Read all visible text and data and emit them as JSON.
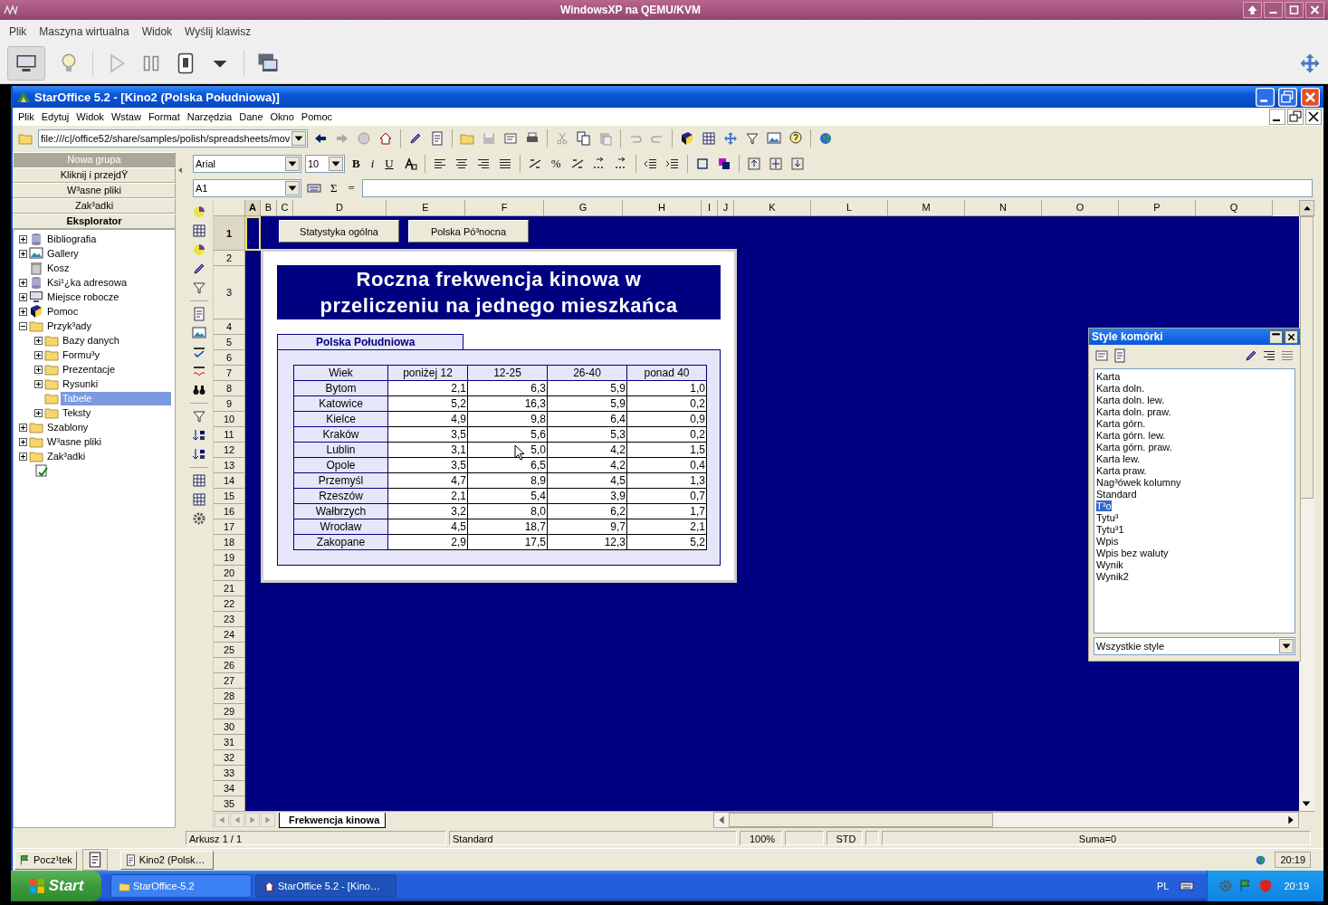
{
  "host": {
    "title": "WindowsXP na QEMU/KVM",
    "menu": [
      "Plik",
      "Maszyna wirtualna",
      "Widok",
      "Wyślij klawisz"
    ]
  },
  "app": {
    "title": "StarOffice 5.2 - [Kino2 (Polska Południowa)]",
    "menu": [
      "Plik",
      "Edytuj",
      "Widok",
      "Wstaw",
      "Format",
      "Narzędzia",
      "Dane",
      "Okno",
      "Pomoc"
    ],
    "url": "file:///c|/office52/share/samples/polish/spreadsheets/mov",
    "font": "Arial",
    "font_size": "10",
    "format_buttons": [
      "B",
      "i",
      "U"
    ],
    "percent": "%",
    "cell_ref": "A1",
    "formula_buttons": [
      "Σ",
      "="
    ]
  },
  "explorer": {
    "groups": [
      {
        "label": "Nowa grupa",
        "selected": true
      },
      {
        "label": "Kliknij i przejdŸ",
        "selected": false
      },
      {
        "label": "W³asne pliki",
        "selected": false
      },
      {
        "label": "Zak³adki",
        "selected": false
      }
    ],
    "title": "Eksplorator",
    "tree": [
      {
        "label": "Bibliografia",
        "kind": "group",
        "expanded": false,
        "selected": false
      },
      {
        "label": "Gallery",
        "kind": "group",
        "expanded": false,
        "selected": false
      },
      {
        "label": "Kosz",
        "kind": "leaf",
        "selected": false
      },
      {
        "label": "Ksi¹¿ka adresowa",
        "kind": "group",
        "expanded": false,
        "selected": false
      },
      {
        "label": "Miejsce robocze",
        "kind": "group",
        "expanded": false,
        "selected": false
      },
      {
        "label": "Pomoc",
        "kind": "group",
        "expanded": false,
        "selected": false
      },
      {
        "label": "Przyk³ady",
        "kind": "group",
        "expanded": true,
        "selected": false,
        "children": [
          {
            "label": "Bazy danych",
            "kind": "group",
            "expanded": false,
            "selected": false
          },
          {
            "label": "Formu³y",
            "kind": "group",
            "expanded": false,
            "selected": false
          },
          {
            "label": "Prezentacje",
            "kind": "group",
            "expanded": false,
            "selected": false
          },
          {
            "label": "Rysunki",
            "kind": "group",
            "expanded": false,
            "selected": false
          },
          {
            "label": "Tabele",
            "kind": "leaf",
            "selected": true
          },
          {
            "label": "Teksty",
            "kind": "group",
            "expanded": false,
            "selected": false
          }
        ]
      },
      {
        "label": "Szablony",
        "kind": "group",
        "expanded": false,
        "selected": false
      },
      {
        "label": "W³asne pliki",
        "kind": "group",
        "expanded": false,
        "selected": false
      },
      {
        "label": "Zak³adki",
        "kind": "group",
        "expanded": false,
        "selected": false
      }
    ]
  },
  "sheet": {
    "columns": [
      {
        "label": "A",
        "selected": true
      },
      {
        "label": "B",
        "selected": false
      },
      {
        "label": "C",
        "selected": false
      },
      {
        "label": "D",
        "selected": false
      },
      {
        "label": "E",
        "selected": false
      },
      {
        "label": "F",
        "selected": false
      },
      {
        "label": "G",
        "selected": false
      },
      {
        "label": "H",
        "selected": false
      },
      {
        "label": "I",
        "selected": false
      },
      {
        "label": "J",
        "selected": false
      },
      {
        "label": "K",
        "selected": false
      },
      {
        "label": "L",
        "selected": false
      },
      {
        "label": "M",
        "selected": false
      },
      {
        "label": "N",
        "selected": false
      },
      {
        "label": "O",
        "selected": false
      },
      {
        "label": "P",
        "selected": false
      },
      {
        "label": "Q",
        "selected": false
      }
    ],
    "rows": [
      {
        "label": "1",
        "selected": true
      },
      {
        "label": "2",
        "selected": false
      },
      {
        "label": "3",
        "selected": false
      },
      {
        "label": "4",
        "selected": false
      },
      {
        "label": "5",
        "selected": false
      },
      {
        "label": "6",
        "selected": false
      },
      {
        "label": "7",
        "selected": false
      },
      {
        "label": "8",
        "selected": false
      },
      {
        "label": "9",
        "selected": false
      },
      {
        "label": "10",
        "selected": false
      },
      {
        "label": "11",
        "selected": false
      },
      {
        "label": "12",
        "selected": false
      },
      {
        "label": "13",
        "selected": false
      },
      {
        "label": "14",
        "selected": false
      },
      {
        "label": "15",
        "selected": false
      },
      {
        "label": "16",
        "selected": false
      },
      {
        "label": "17",
        "selected": false
      },
      {
        "label": "18",
        "selected": false
      },
      {
        "label": "19",
        "selected": false
      },
      {
        "label": "20",
        "selected": false
      },
      {
        "label": "21",
        "selected": false
      },
      {
        "label": "22",
        "selected": false
      },
      {
        "label": "23",
        "selected": false
      },
      {
        "label": "24",
        "selected": false
      },
      {
        "label": "25",
        "selected": false
      },
      {
        "label": "26",
        "selected": false
      },
      {
        "label": "27",
        "selected": false
      },
      {
        "label": "28",
        "selected": false
      },
      {
        "label": "29",
        "selected": false
      },
      {
        "label": "30",
        "selected": false
      },
      {
        "label": "31",
        "selected": false
      },
      {
        "label": "32",
        "selected": false
      },
      {
        "label": "33",
        "selected": false
      },
      {
        "label": "34",
        "selected": false
      },
      {
        "label": "35",
        "selected": false
      }
    ],
    "buttons": [
      "Statystyka ogólna",
      "Polska Pó³nocna"
    ],
    "title": "Roczna frekwencja kinowa w przeliczeniu na jednego mieszkańca",
    "region_tab": "Polska Południowa",
    "table": {
      "columns": [
        "Wiek",
        "poniżej 12",
        "12-25",
        "26-40",
        "ponad 40"
      ],
      "rows": [
        {
          "city": "Bytom",
          "values": [
            "2,1",
            "6,3",
            "5,9",
            "1,0"
          ]
        },
        {
          "city": "Katowice",
          "values": [
            "5,2",
            "16,3",
            "5,9",
            "0,2"
          ]
        },
        {
          "city": "Kielce",
          "values": [
            "4,9",
            "9,8",
            "6,4",
            "0,9"
          ]
        },
        {
          "city": "Kraków",
          "values": [
            "3,5",
            "5,6",
            "5,3",
            "0,2"
          ]
        },
        {
          "city": "Lublin",
          "values": [
            "3,1",
            "5,0",
            "4,2",
            "1,5"
          ]
        },
        {
          "city": "Opole",
          "values": [
            "3,5",
            "6,5",
            "4,2",
            "0,4"
          ]
        },
        {
          "city": "Przemyśl",
          "values": [
            "4,7",
            "8,9",
            "4,5",
            "1,3"
          ]
        },
        {
          "city": "Rzeszów",
          "values": [
            "2,1",
            "5,4",
            "3,9",
            "0,7"
          ]
        },
        {
          "city": "Wałbrzych",
          "values": [
            "3,2",
            "8,0",
            "6,2",
            "1,7"
          ]
        },
        {
          "city": "Wrocław",
          "values": [
            "4,5",
            "18,7",
            "9,7",
            "2,1"
          ]
        },
        {
          "city": "Zakopane",
          "values": [
            "2,9",
            "17,5",
            "12,3",
            "5,2"
          ]
        }
      ]
    },
    "tabs": [
      {
        "label": "Frekwencja kinowa",
        "selected": true
      }
    ]
  },
  "status_bar": {
    "sheet": "Arkusz 1 / 1",
    "style": "Standard",
    "zoom": "100%",
    "mode": "STD",
    "sum": "Suma=0"
  },
  "styles_panel": {
    "title": "Style komórki",
    "items": [
      {
        "label": "Karta",
        "selected": false
      },
      {
        "label": "Karta doln.",
        "selected": false
      },
      {
        "label": "Karta doln. lew.",
        "selected": false
      },
      {
        "label": "Karta doln. praw.",
        "selected": false
      },
      {
        "label": "Karta górn.",
        "selected": false
      },
      {
        "label": "Karta górn. lew.",
        "selected": false
      },
      {
        "label": "Karta górn. praw.",
        "selected": false
      },
      {
        "label": "Karta lew.",
        "selected": false
      },
      {
        "label": "Karta praw.",
        "selected": false
      },
      {
        "label": "Nag³ówek kolumny",
        "selected": false
      },
      {
        "label": "Standard",
        "selected": false
      },
      {
        "label": "T³o",
        "selected": true
      },
      {
        "label": "Tytu³",
        "selected": false
      },
      {
        "label": "Tytu³1",
        "selected": false
      },
      {
        "label": "Wpis",
        "selected": false
      },
      {
        "label": "Wpis bez waluty",
        "selected": false
      },
      {
        "label": "Wynik",
        "selected": false
      },
      {
        "label": "Wynik2",
        "selected": false
      }
    ],
    "filter": "Wszystkie style"
  },
  "desktop_bar": {
    "start": "Pocz¹tek",
    "tasks": [
      {
        "label": "Kino2 (Polsk…",
        "selected": false
      }
    ],
    "clock": "20:19"
  },
  "taskbar": {
    "start": "Start",
    "tasks": [
      {
        "label": "StarOffice-5.2",
        "selected": false
      },
      {
        "label": "StarOffice 5.2 - [Kino…",
        "selected": true
      }
    ],
    "language": "PL",
    "clock": "20:19"
  }
}
